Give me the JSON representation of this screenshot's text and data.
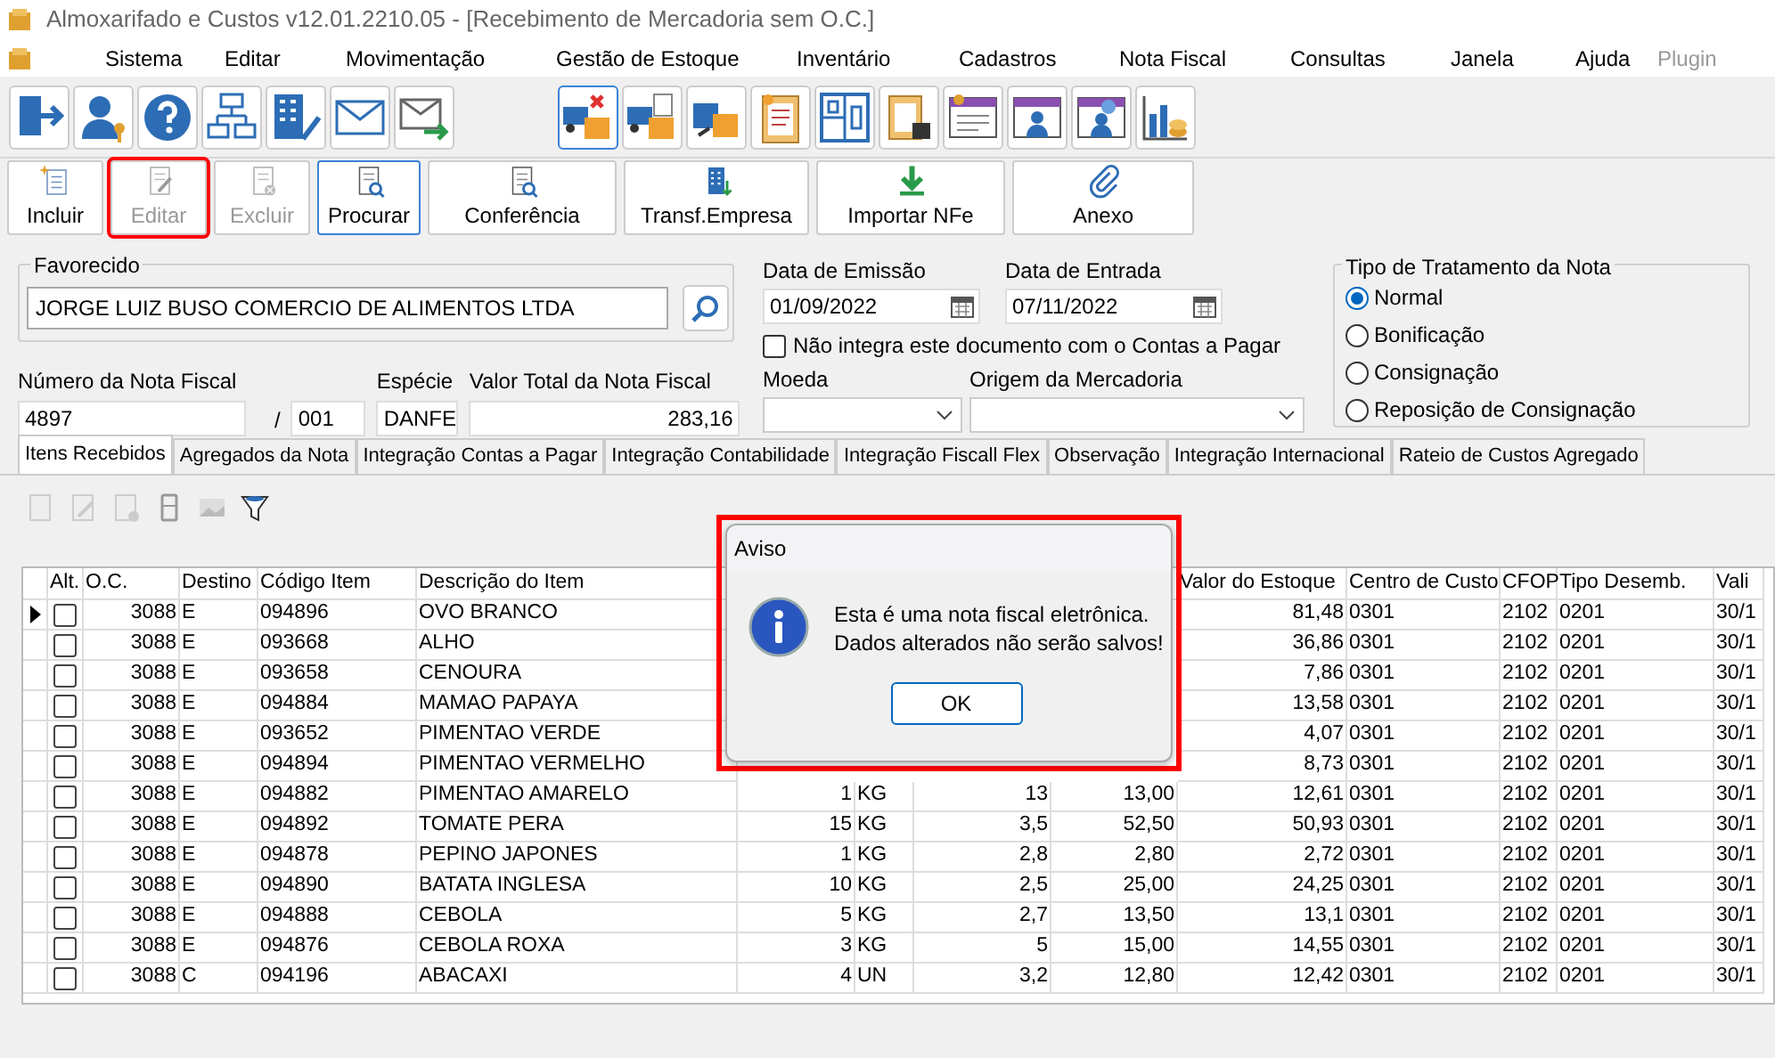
{
  "window": {
    "title": "Almoxarifado e Custos v12.01.2210.05 - [Recebimento de Mercadoria sem O.C.]"
  },
  "menu": [
    {
      "label": "Sistema",
      "disabled": false
    },
    {
      "label": "Editar",
      "disabled": false
    },
    {
      "label": "Movimentação",
      "disabled": false
    },
    {
      "label": "Gestão de Estoque",
      "disabled": false
    },
    {
      "label": "Inventário",
      "disabled": false
    },
    {
      "label": "Cadastros",
      "disabled": false
    },
    {
      "label": "Nota Fiscal",
      "disabled": false
    },
    {
      "label": "Consultas",
      "disabled": false
    },
    {
      "label": "Janela",
      "disabled": false
    },
    {
      "label": "Ajuda",
      "disabled": false
    },
    {
      "label": "Plugin",
      "disabled": true
    }
  ],
  "actions": [
    {
      "label": "Incluir",
      "disabled": false,
      "focused": false,
      "highlighted": false
    },
    {
      "label": "Editar",
      "disabled": true,
      "focused": false,
      "highlighted": true
    },
    {
      "label": "Excluir",
      "disabled": true,
      "focused": false,
      "highlighted": false
    },
    {
      "label": "Procurar",
      "disabled": false,
      "focused": true,
      "highlighted": false
    },
    {
      "label": "Conferência",
      "disabled": false,
      "focused": false,
      "highlighted": false
    },
    {
      "label": "Transf.Empresa",
      "disabled": false,
      "focused": false,
      "highlighted": false
    },
    {
      "label": "Importar NFe",
      "disabled": false,
      "focused": false,
      "highlighted": false
    },
    {
      "label": "Anexo",
      "disabled": false,
      "focused": false,
      "highlighted": false
    }
  ],
  "form": {
    "favorecido": {
      "label": "Favorecido",
      "value": "JORGE LUIZ BUSO COMERCIO DE ALIMENTOS LTDA"
    },
    "data_emissao": {
      "label": "Data de Emissão",
      "value": "01/09/2022"
    },
    "data_entrada": {
      "label": "Data de Entrada",
      "value": "07/11/2022"
    },
    "nao_integra": {
      "label": "Não integra este documento com o Contas a Pagar",
      "checked": false
    },
    "numero_nf": {
      "label": "Número da Nota Fiscal",
      "value": "4897",
      "separator": "/",
      "serie": "001"
    },
    "especie": {
      "label": "Espécie",
      "value": "DANFE"
    },
    "valor_total": {
      "label": "Valor Total da Nota Fiscal",
      "value": "283,16"
    },
    "moeda": {
      "label": "Moeda"
    },
    "origem": {
      "label": "Origem da Mercadoria"
    },
    "tipo_tratamento": {
      "label": "Tipo de Tratamento da Nota",
      "options": [
        {
          "label": "Normal",
          "selected": true
        },
        {
          "label": "Bonificação",
          "selected": false
        },
        {
          "label": "Consignação",
          "selected": false
        },
        {
          "label": "Reposição de Consignação",
          "selected": false
        }
      ]
    }
  },
  "tabs": [
    {
      "label": "Itens Recebidos",
      "selected": true
    },
    {
      "label": "Agregados da Nota",
      "selected": false
    },
    {
      "label": "Integração Contas a Pagar",
      "selected": false
    },
    {
      "label": "Integração Contabilidade",
      "selected": false
    },
    {
      "label": "Integração Fiscall Flex",
      "selected": false
    },
    {
      "label": "Observação",
      "selected": false
    },
    {
      "label": "Integração Internacional",
      "selected": false
    },
    {
      "label": "Rateio de Custos Agregado",
      "selected": false
    }
  ],
  "table": {
    "columns": {
      "alt": "Alt.",
      "oc": "O.C.",
      "destino": "Destino",
      "codigo_item": "Código Item",
      "descricao": "Descrição do Item",
      "valor_estoque": "Valor do Estoque",
      "centro_de_custo": "Centro de Custo",
      "cfop": "CFOP",
      "tipo_desemb": "Tipo Desemb.",
      "column_14": "Vali"
    },
    "rows": [
      {
        "selected": true,
        "checked": false,
        "oc": "3088",
        "destino": "E",
        "codigo_item": "094896",
        "descricao": "OVO BRANCO",
        "valor_estoque": "81,48",
        "centro_de_custo": "0301",
        "cfop": "2102",
        "tipo_desemb": "0201",
        "column_14": "30/1"
      },
      {
        "selected": false,
        "checked": false,
        "oc": "3088",
        "destino": "E",
        "codigo_item": "093668",
        "descricao": "ALHO",
        "valor_estoque": "36,86",
        "centro_de_custo": "0301",
        "cfop": "2102",
        "tipo_desemb": "0201",
        "column_14": "30/1"
      },
      {
        "selected": false,
        "checked": false,
        "oc": "3088",
        "destino": "E",
        "codigo_item": "093658",
        "descricao": "CENOURA",
        "valor_estoque": "7,86",
        "centro_de_custo": "0301",
        "cfop": "2102",
        "tipo_desemb": "0201",
        "column_14": "30/1"
      },
      {
        "selected": false,
        "checked": false,
        "oc": "3088",
        "destino": "E",
        "codigo_item": "094884",
        "descricao": "MAMAO PAPAYA",
        "valor_estoque": "13,58",
        "centro_de_custo": "0301",
        "cfop": "2102",
        "tipo_desemb": "0201",
        "column_14": "30/1"
      },
      {
        "selected": false,
        "checked": false,
        "oc": "3088",
        "destino": "E",
        "codigo_item": "093652",
        "descricao": "PIMENTAO VERDE",
        "valor_estoque": "4,07",
        "centro_de_custo": "0301",
        "cfop": "2102",
        "tipo_desemb": "0201",
        "column_14": "30/1"
      },
      {
        "selected": false,
        "checked": false,
        "oc": "3088",
        "destino": "E",
        "codigo_item": "094894",
        "descricao": "PIMENTAO VERMELHO",
        "valor_estoque": "8,73",
        "centro_de_custo": "0301",
        "cfop": "2102",
        "tipo_desemb": "0201",
        "column_14": "30/1"
      },
      {
        "selected": false,
        "checked": false,
        "oc": "3088",
        "destino": "E",
        "codigo_item": "094882",
        "descricao": "PIMENTAO AMARELO",
        "column_6": "1",
        "column_7": "KG",
        "column_8": "13",
        "column_9": "13,00",
        "valor_estoque": "12,61",
        "centro_de_custo": "0301",
        "cfop": "2102",
        "tipo_desemb": "0201",
        "column_14": "30/1"
      },
      {
        "selected": false,
        "checked": false,
        "oc": "3088",
        "destino": "E",
        "codigo_item": "094892",
        "descricao": "TOMATE PERA",
        "column_6": "15",
        "column_7": "KG",
        "column_8": "3,5",
        "column_9": "52,50",
        "valor_estoque": "50,93",
        "centro_de_custo": "0301",
        "cfop": "2102",
        "tipo_desemb": "0201",
        "column_14": "30/1"
      },
      {
        "selected": false,
        "checked": false,
        "oc": "3088",
        "destino": "E",
        "codigo_item": "094878",
        "descricao": "PEPINO JAPONES",
        "column_6": "1",
        "column_7": "KG",
        "column_8": "2,8",
        "column_9": "2,80",
        "valor_estoque": "2,72",
        "centro_de_custo": "0301",
        "cfop": "2102",
        "tipo_desemb": "0201",
        "column_14": "30/1"
      },
      {
        "selected": false,
        "checked": false,
        "oc": "3088",
        "destino": "E",
        "codigo_item": "094890",
        "descricao": "BATATA INGLESA",
        "column_6": "10",
        "column_7": "KG",
        "column_8": "2,5",
        "column_9": "25,00",
        "valor_estoque": "24,25",
        "centro_de_custo": "0301",
        "cfop": "2102",
        "tipo_desemb": "0201",
        "column_14": "30/1"
      },
      {
        "selected": false,
        "checked": false,
        "oc": "3088",
        "destino": "E",
        "codigo_item": "094888",
        "descricao": "CEBOLA",
        "column_6": "5",
        "column_7": "KG",
        "column_8": "2,7",
        "column_9": "13,50",
        "valor_estoque": "13,1",
        "centro_de_custo": "0301",
        "cfop": "2102",
        "tipo_desemb": "0201",
        "column_14": "30/1"
      },
      {
        "selected": false,
        "checked": false,
        "oc": "3088",
        "destino": "E",
        "codigo_item": "094876",
        "descricao": "CEBOLA ROXA",
        "column_6": "3",
        "column_7": "KG",
        "column_8": "5",
        "column_9": "15,00",
        "valor_estoque": "14,55",
        "centro_de_custo": "0301",
        "cfop": "2102",
        "tipo_desemb": "0201",
        "column_14": "30/1"
      },
      {
        "selected": false,
        "checked": false,
        "oc": "3088",
        "destino": "C",
        "codigo_item": "094196",
        "descricao": "ABACAXI",
        "column_6": "4",
        "column_7": "UN",
        "column_8": "3,2",
        "column_9": "12,80",
        "valor_estoque": "12,42",
        "centro_de_custo": "0301",
        "cfop": "2102",
        "tipo_desemb": "0201",
        "column_14": "30/1"
      }
    ]
  },
  "dialog": {
    "title": "Aviso",
    "message": [
      "Esta é uma nota fiscal eletrônica.",
      "Dados alterados não serão salvos!"
    ],
    "button": "OK",
    "highlighted": true
  }
}
